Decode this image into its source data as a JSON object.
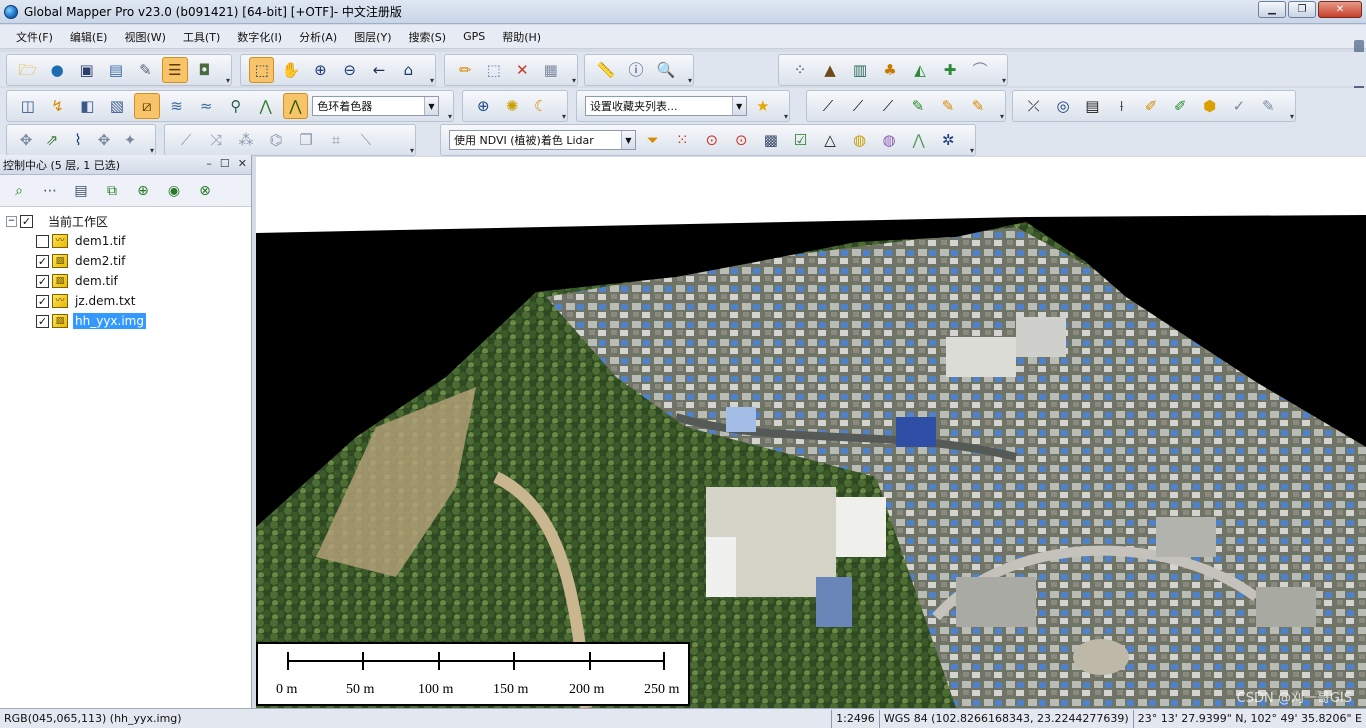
{
  "window": {
    "title": "Global Mapper Pro v23.0 (b091421) [64-bit] [+OTF]- 中文注册版",
    "minimize": "▁",
    "maximize": "❐",
    "close": "✕"
  },
  "menu": [
    "文件(F)",
    "编辑(E)",
    "视图(W)",
    "工具(T)",
    "数字化(I)",
    "分析(A)",
    "图层(Y)",
    "搜索(S)",
    "GPS",
    "帮助(H)"
  ],
  "toolbar": {
    "shader_select": "色环着色器",
    "favorites_select": "设置收藏夹列表...",
    "lidar_select": "使用 NDVI (植被)着色 Lidar"
  },
  "panel": {
    "title": "控制中心 (5 层, 1 已选)",
    "minimize": "–",
    "restore": "☐",
    "close": "✕"
  },
  "layers": {
    "root_label": "当前工作区",
    "items": [
      {
        "name": "dem1.tif",
        "checked": false,
        "mark": ""
      },
      {
        "name": "dem2.tif",
        "checked": true,
        "mark": "✓"
      },
      {
        "name": "dem.tif",
        "checked": true,
        "mark": "✓"
      },
      {
        "name": "jz.dem.txt",
        "checked": true,
        "mark": "✓"
      },
      {
        "name": "hh_yyx.img",
        "checked": true,
        "mark": "✓"
      }
    ]
  },
  "scalebar": {
    "labels": [
      "0 m",
      "50 m",
      "100 m",
      "150 m",
      "200 m",
      "250 m"
    ]
  },
  "watermark": "CSDN @刈一哥GIS",
  "status": {
    "left": "RGB(045,065,113) (hh_yyx.img)",
    "scale": "1:2496",
    "datum": "WGS 84 (102.8266168343, 23.2244277639)",
    "dms": "23° 13' 27.9399\" N, 102° 49' 35.8206\" E"
  },
  "colors": {
    "accent": "#3399ff",
    "active_tool": "#f7c46a",
    "map_nodata": "#000000"
  }
}
